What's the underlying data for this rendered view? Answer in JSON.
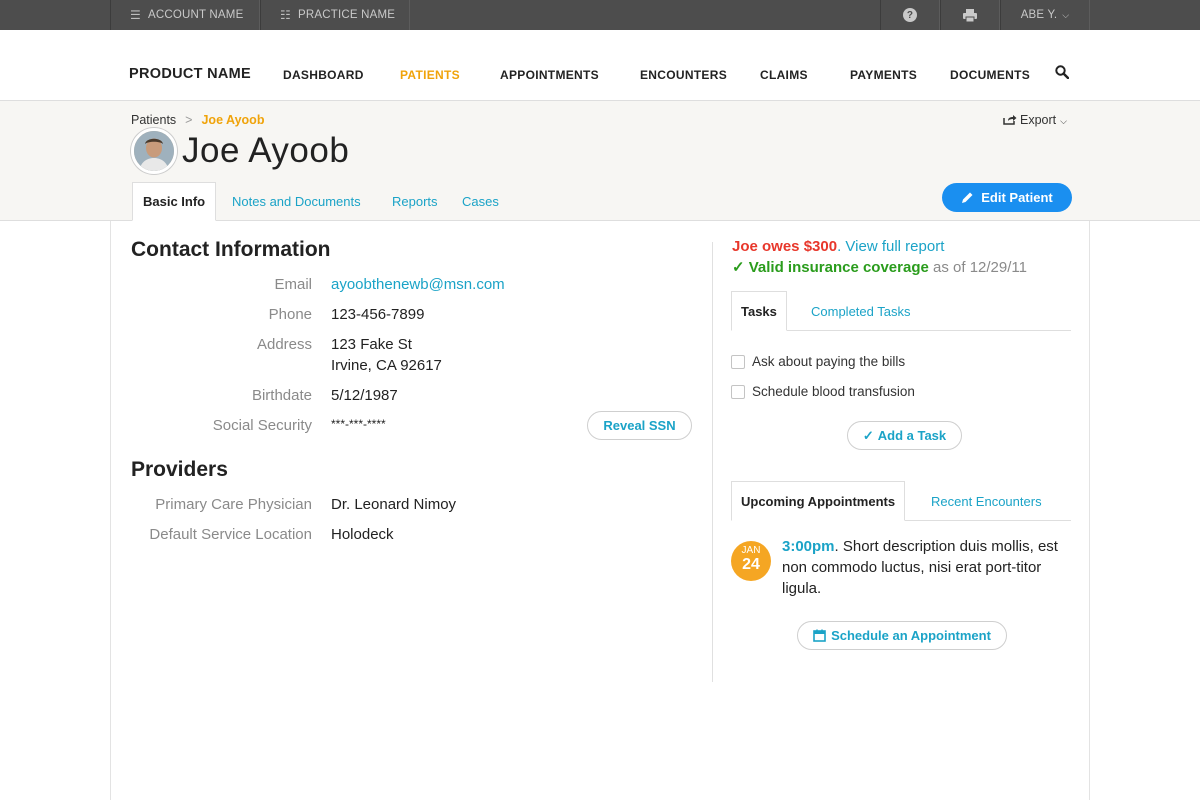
{
  "topbar": {
    "account": "ACCOUNT NAME",
    "practice": "PRACTICE NAME",
    "user": "ABE Y."
  },
  "nav": {
    "brand": "PRODUCT NAME",
    "items": [
      "DASHBOARD",
      "PATIENTS",
      "APPOINTMENTS",
      "ENCOUNTERS",
      "CLAIMS",
      "PAYMENTS",
      "DOCUMENTS"
    ],
    "active": "PATIENTS"
  },
  "breadcrumb": {
    "parent": "Patients",
    "separator": ">",
    "current": "Joe Ayoob"
  },
  "export_label": "Export",
  "patient": {
    "name": "Joe Ayoob"
  },
  "tabs": [
    "Basic Info",
    "Notes and Documents",
    "Reports",
    "Cases"
  ],
  "edit_button": "Edit Patient",
  "contact": {
    "heading": "Contact Information",
    "email_label": "Email",
    "email": "ayoobthenewb@msn.com",
    "phone_label": "Phone",
    "phone": "123-456-7899",
    "address_label": "Address",
    "address_line1": "123 Fake St",
    "address_line2": "Irvine, CA 92617",
    "birthdate_label": "Birthdate",
    "birthdate": "5/12/1987",
    "ssn_label": "Social Security",
    "ssn": "***-***-****",
    "reveal_ssn": "Reveal SSN"
  },
  "providers": {
    "heading": "Providers",
    "pcp_label": "Primary Care Physician",
    "pcp": "Dr. Leonard Nimoy",
    "location_label": "Default Service Location",
    "location": "Holodeck"
  },
  "balance": {
    "owes": "Joe owes $300",
    "period": ".",
    "report_link": "View full report",
    "check": "✓",
    "insurance": "Valid insurance coverage",
    "as_of": "as of 12/29/11"
  },
  "tasks": {
    "tabs": [
      "Tasks",
      "Completed Tasks"
    ],
    "items": [
      "Ask about paying the bills",
      "Schedule blood transfusion"
    ],
    "add_button": "Add a Task"
  },
  "appointments": {
    "tabs": [
      "Upcoming Appointments",
      "Recent Encounters"
    ],
    "month": "JAN",
    "day": "24",
    "time": "3:00pm",
    "description": ". Short description duis mollis, est non commodo luctus, nisi erat port-titor ligula.",
    "schedule_button": "Schedule an Appointment"
  },
  "colors": {
    "accent_orange": "#f0a30a",
    "link_blue": "#1ba3c7",
    "button_blue": "#1a8ff0",
    "owes_red": "#e8372b",
    "insurance_green": "#2a9c1c",
    "topbar_bg": "#4d4d4d"
  }
}
